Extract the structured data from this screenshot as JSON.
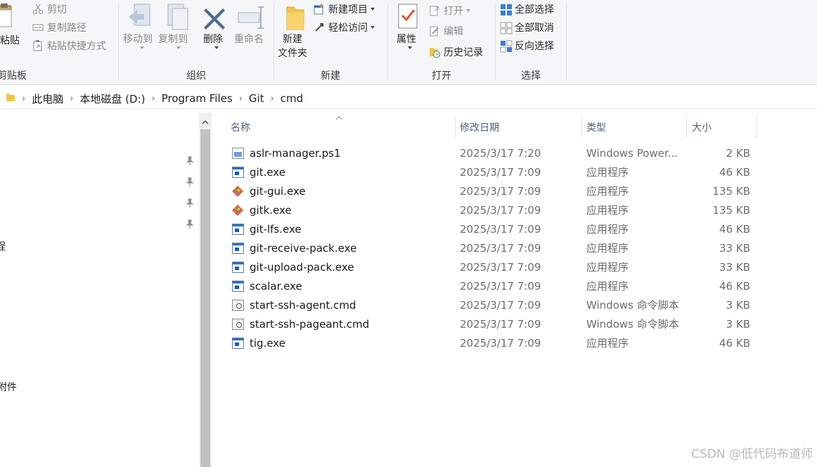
{
  "ribbon": {
    "clipboard": {
      "paste_label": "粘贴",
      "cut_label": "剪切",
      "copy_path_label": "复制路径",
      "paste_shortcut_label": "粘贴快捷方式",
      "group_label": "剪贴板"
    },
    "organize": {
      "move_to_label": "移动到",
      "copy_to_label": "复制到",
      "delete_label": "删除",
      "rename_label": "重命名",
      "group_label": "组织"
    },
    "new": {
      "new_item_label": "新建项目",
      "easy_access_label": "轻松访问",
      "new_folder_label_1": "新建",
      "new_folder_label_2": "文件夹",
      "group_label": "新建"
    },
    "open": {
      "properties_label": "属性",
      "open_label": "打开",
      "edit_label": "编辑",
      "history_label": "历史记录",
      "group_label": "打开"
    },
    "select": {
      "select_all_label": "全部选择",
      "select_none_label": "全部取消",
      "invert_selection_label": "反向选择",
      "group_label": "选择"
    }
  },
  "breadcrumb": [
    "此电脑",
    "本地磁盘 (D:)",
    "Program Files",
    "Git",
    "cmd"
  ],
  "nav": {
    "fragment_1": "程",
    "fragment_2": "附件"
  },
  "columns": {
    "name": "名称",
    "date": "修改日期",
    "type": "类型",
    "size": "大小"
  },
  "files": [
    {
      "name": "aslr-manager.ps1",
      "date": "2025/3/17 7:20",
      "type": "Windows Power...",
      "size": "2 KB",
      "icon": "powershell-script-icon"
    },
    {
      "name": "git.exe",
      "date": "2025/3/17 7:09",
      "type": "应用程序",
      "size": "46 KB",
      "icon": "application-icon"
    },
    {
      "name": "git-gui.exe",
      "date": "2025/3/17 7:09",
      "type": "应用程序",
      "size": "135 KB",
      "icon": "git-logo-icon"
    },
    {
      "name": "gitk.exe",
      "date": "2025/3/17 7:09",
      "type": "应用程序",
      "size": "135 KB",
      "icon": "git-logo-icon"
    },
    {
      "name": "git-lfs.exe",
      "date": "2025/3/17 7:09",
      "type": "应用程序",
      "size": "46 KB",
      "icon": "application-icon"
    },
    {
      "name": "git-receive-pack.exe",
      "date": "2025/3/17 7:09",
      "type": "应用程序",
      "size": "33 KB",
      "icon": "application-icon"
    },
    {
      "name": "git-upload-pack.exe",
      "date": "2025/3/17 7:09",
      "type": "应用程序",
      "size": "33 KB",
      "icon": "application-icon"
    },
    {
      "name": "scalar.exe",
      "date": "2025/3/17 7:09",
      "type": "应用程序",
      "size": "46 KB",
      "icon": "application-icon"
    },
    {
      "name": "start-ssh-agent.cmd",
      "date": "2025/3/17 7:09",
      "type": "Windows 命令脚本",
      "size": "3 KB",
      "icon": "cmd-script-icon"
    },
    {
      "name": "start-ssh-pageant.cmd",
      "date": "2025/3/17 7:09",
      "type": "Windows 命令脚本",
      "size": "3 KB",
      "icon": "cmd-script-icon"
    },
    {
      "name": "tig.exe",
      "date": "2025/3/17 7:09",
      "type": "应用程序",
      "size": "46 KB",
      "icon": "application-icon"
    }
  ],
  "watermark": "CSDN @低代码布道师",
  "colors": {
    "ribbon_bg": "#f5f6f7",
    "header_text": "#4c607a",
    "folder_yellow": "#f3c54b",
    "accent_blue": "#2f6fc1"
  }
}
